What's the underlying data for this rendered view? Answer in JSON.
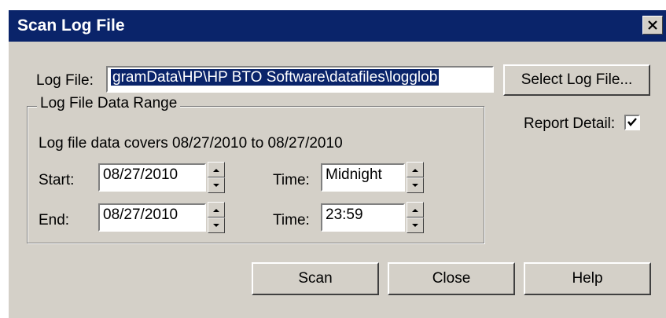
{
  "window": {
    "title": "Scan Log File"
  },
  "log_file": {
    "label": "Log File:",
    "value": "gramData\\HP\\HP BTO Software\\datafiles\\logglob",
    "select_button": "Select Log File..."
  },
  "report_detail": {
    "label": "Report Detail:",
    "checked": true
  },
  "range": {
    "group_label": "Log File Data Range",
    "coverage": "Log file data covers 08/27/2010 to 08/27/2010",
    "start_label": "Start:",
    "start_date": "08/27/2010",
    "start_time_label": "Time:",
    "start_time": "Midnight",
    "end_label": "End:",
    "end_date": "08/27/2010",
    "end_time_label": "Time:",
    "end_time": "23:59"
  },
  "buttons": {
    "scan": "Scan",
    "close": "Close",
    "help": "Help"
  },
  "icons": {
    "close": "close-icon",
    "spin_up": "spin-up-icon",
    "spin_down": "spin-down-icon",
    "check": "checkmark-icon"
  }
}
